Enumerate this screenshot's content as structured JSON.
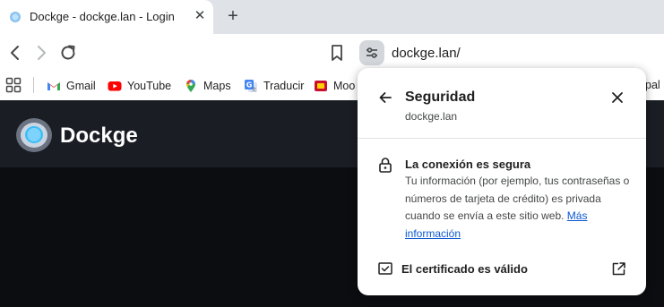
{
  "tab": {
    "title": "Dockge - dockge.lan - Login",
    "close": "✕",
    "new_tab": "+"
  },
  "toolbar": {
    "url": "dockge.lan/"
  },
  "bookmarks": {
    "items": [
      {
        "label": "Gmail",
        "icon": "gmail-icon"
      },
      {
        "label": "YouTube",
        "icon": "youtube-icon"
      },
      {
        "label": "Maps",
        "icon": "maps-icon"
      },
      {
        "label": "Traducir",
        "icon": "translate-icon"
      },
      {
        "label": "Moo",
        "icon": "moodle-icon"
      }
    ],
    "overflow_tail": "pal"
  },
  "page": {
    "brand": "Dockge"
  },
  "security_popup": {
    "title": "Seguridad",
    "domain": "dockge.lan",
    "connection_title": "La conexión es segura",
    "connection_desc": "Tu información (por ejemplo, tus contraseñas o números de tarjeta de crédito) es privada cuando se envía a este sitio web.",
    "more_info_link": "Más información",
    "certificate_label": "El certificado es válido"
  },
  "colors": {
    "link": "#0b57d0",
    "page_bg": "#0b0d11",
    "header_bg": "#1a1d23"
  }
}
